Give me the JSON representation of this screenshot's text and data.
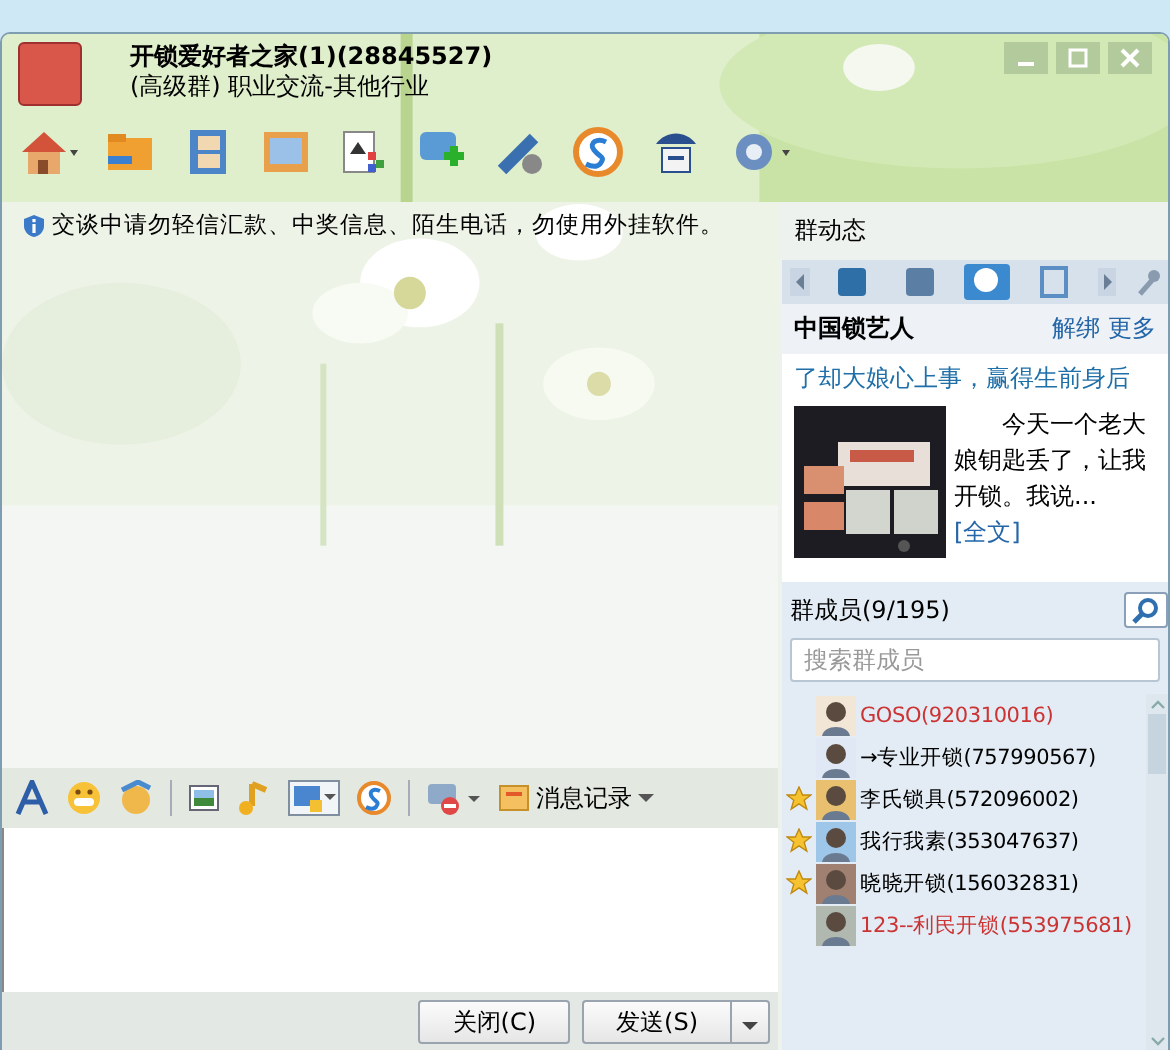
{
  "window": {
    "title": "开锁爱好者之家(1)(28845527)",
    "subtitle": "(高级群) 职业交流-其他行业"
  },
  "notice": "交谈中请勿轻信汇款、中奖信息、陌生电话，勿使用外挂软件。",
  "feed": {
    "heading": "群动态",
    "tabs": [
      {
        "selected": false
      },
      {
        "selected": false
      },
      {
        "selected": true
      },
      {
        "selected": false
      }
    ],
    "source": "中国锁艺人",
    "actions": [
      "解绑",
      "更多"
    ],
    "post_title": "了却大娘心上事，赢得生前身后",
    "post_text": "今天一个老大娘钥匙丢了，让我开锁。我说...",
    "post_link": "[全文]"
  },
  "members": {
    "heading": "群成员(9/195)",
    "search": {
      "placeholder": "搜索群成员"
    },
    "items": [
      {
        "name": "GOSO(920310016)",
        "color": "#cc3333",
        "starred": false
      },
      {
        "name": "→专业开锁(757990567)",
        "color": "#000000",
        "starred": false
      },
      {
        "name": "李氏锁具(572096002)",
        "color": "#000000",
        "starred": true
      },
      {
        "name": "我行我素(353047637)",
        "color": "#000000",
        "starred": true
      },
      {
        "name": "晓晓开锁(156032831)",
        "color": "#000000",
        "starred": true
      },
      {
        "name": "123--利民开锁(553975681)",
        "color": "#cc3333",
        "starred": false
      }
    ]
  },
  "input_toolbar": {
    "history": "消息记录"
  },
  "buttons": {
    "close": "关闭(C)",
    "send": "发送(S)"
  }
}
